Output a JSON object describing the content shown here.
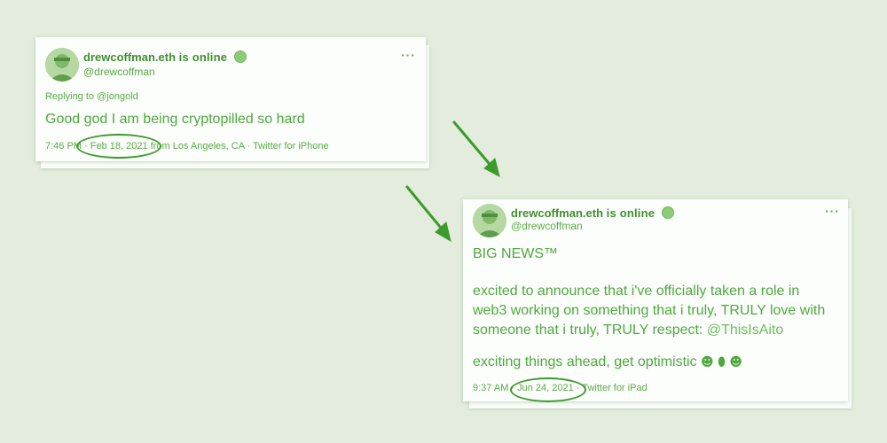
{
  "tweet1": {
    "display_name": "drewcoffman.eth",
    "status": "is online",
    "handle": "@drewcoffman",
    "more": "···",
    "reply_prefix": "Replying to",
    "reply_mention": "@jongold",
    "text": "Good god I am being cryptopilled so hard",
    "time": "7:46 PM",
    "date": "· Feb 18, 2021",
    "location_source": "from Los Angeles, CA · Twitter for iPhone"
  },
  "tweet2": {
    "display_name": "drewcoffman.eth",
    "status": "is online",
    "handle": "@drewcoffman",
    "more": "···",
    "headline": "BIG NEWS™",
    "para1_a": "excited to announce that i've officially taken a role in",
    "para1_b": "web3 working on something that i truly, TRULY love with",
    "para1_c": "someone that i truly, TRULY respect:",
    "mention": "@ThisIsAito",
    "para2": "exciting things ahead, get optimistic",
    "emoji": "☻ ⬮ ☻",
    "time": "9:37 AM",
    "date": "· Jun 24, 2021 ·",
    "source": "Twitter for iPad"
  },
  "icons": [
    "avatar",
    "status-dot-icon",
    "more-icon",
    "arrow-icon"
  ],
  "colors": {
    "background": "#e3ecdd",
    "accent": "#4fa83f",
    "annotation": "#3d9a2d"
  }
}
